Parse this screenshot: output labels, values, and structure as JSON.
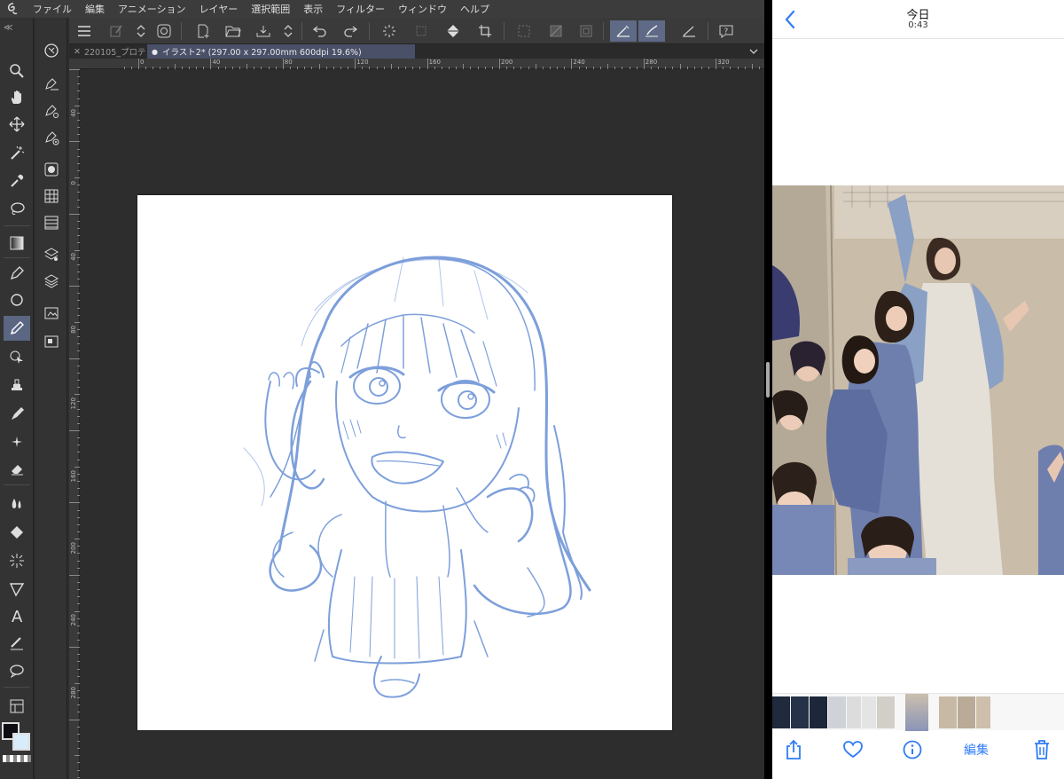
{
  "menu": [
    "ファイル",
    "編集",
    "アニメーション",
    "レイヤー",
    "選択範囲",
    "表示",
    "フィルター",
    "ウィンドウ",
    "ヘルプ"
  ],
  "tabs": {
    "inactive": "220105_プロテ",
    "active": "イラスト2* (297.00 x 297.00mm 600dpi 19.6%)"
  },
  "rulers": {
    "horizontal": [
      "0",
      "40",
      "80",
      "120",
      "160",
      "200",
      "240",
      "280",
      "320"
    ],
    "vertical": [
      "40",
      "0",
      "40",
      "80",
      "120",
      "160",
      "200",
      "240",
      "280"
    ]
  },
  "colors": {
    "accent_active": "#5a6682",
    "sketch_stroke": "#6f95d8",
    "canvas_bg": "#2d2d2d",
    "ios_blue": "#2f7cf6"
  },
  "photos": {
    "title": "今日",
    "time": "0:43",
    "actions": {
      "edit_label": "編集"
    },
    "icons": [
      "share-icon",
      "heart-icon",
      "info-icon",
      "trash-icon"
    ]
  }
}
